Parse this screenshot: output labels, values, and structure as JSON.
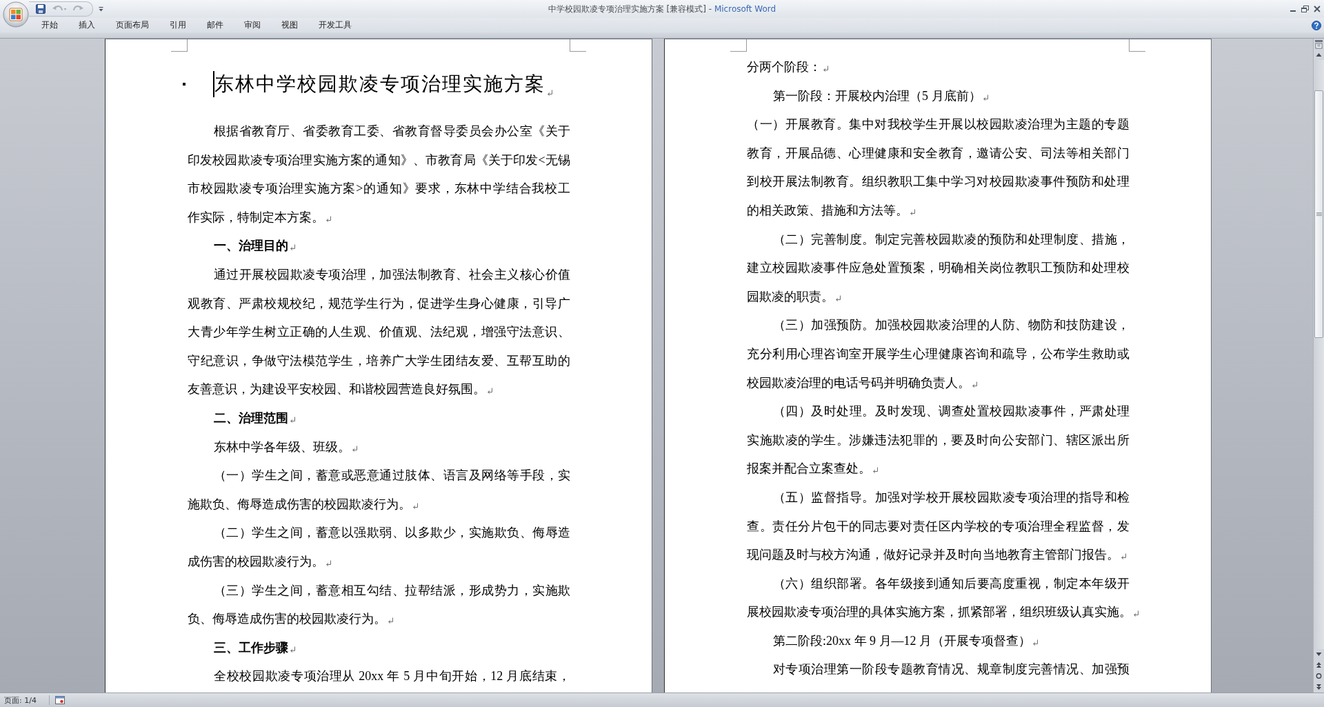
{
  "window": {
    "document": "中学校园欺凌专项治理实施方案 [兼容模式] -",
    "app": "Microsoft Word"
  },
  "quick_access": [
    {
      "kind": "save",
      "disabled": false
    },
    {
      "kind": "undo",
      "disabled": true
    },
    {
      "kind": "redo",
      "disabled": true
    },
    {
      "kind": "customize"
    }
  ],
  "ribbon_tabs": [
    {
      "label": "开始",
      "selected": false
    },
    {
      "label": "插入",
      "selected": false
    },
    {
      "label": "页面布局",
      "selected": false
    },
    {
      "label": "引用",
      "selected": false
    },
    {
      "label": "邮件",
      "selected": false
    },
    {
      "label": "审阅",
      "selected": false
    },
    {
      "label": "视图",
      "selected": false
    },
    {
      "label": "开发工具",
      "selected": false
    }
  ],
  "pages": [
    {
      "title": {
        "text": "东林中学校园欺凌专项治理实施方案",
        "bullet": true,
        "caret": true,
        "end_mark": true
      },
      "paragraphs": [
        {
          "kind": "body",
          "indent": true,
          "end_mark": true,
          "lines": [
            "根据省教育厅、省委教育工委、省教育督导委员会办公室《关于",
            "印发校园欺凌专项治理实施方案的通知》、市教育局《关于印发<无锡",
            "市校园欺凌专项治理实施方案>的通知》要求，东林中学结合我校工",
            "作实际，特制定本方案。"
          ]
        },
        {
          "kind": "heading",
          "indent": true,
          "end_mark": true,
          "lines": [
            "一、治理目的"
          ]
        },
        {
          "kind": "body",
          "indent": true,
          "end_mark": true,
          "lines": [
            "通过开展校园欺凌专项治理，加强法制教育、社会主义核心价值",
            "观教育、严肃校规校纪，规范学生行为，促进学生身心健康，引导广",
            "大青少年学生树立正确的人生观、价值观、法纪观，增强守法意识、",
            "守纪意识，争做守法模范学生，培养广大学生团结友爱、互帮互助的",
            "友善意识，为建设平安校园、和谐校园营造良好氛围。"
          ]
        },
        {
          "kind": "heading",
          "indent": true,
          "end_mark": true,
          "lines": [
            "二、治理范围"
          ]
        },
        {
          "kind": "body",
          "indent": true,
          "end_mark": true,
          "lines": [
            "东林中学各年级、班级。"
          ]
        },
        {
          "kind": "body",
          "indent": true,
          "end_mark": true,
          "lines": [
            "（一）学生之间，蓄意或恶意通过肢体、语言及网络等手段，实",
            "施欺负、侮辱造成伤害的校园欺凌行为。"
          ]
        },
        {
          "kind": "body",
          "indent": true,
          "end_mark": true,
          "lines": [
            "（二）学生之间，蓄意以强欺弱、以多欺少，实施欺负、侮辱造",
            "成伤害的校园欺凌行为。"
          ]
        },
        {
          "kind": "body",
          "indent": true,
          "end_mark": true,
          "lines": [
            "（三）学生之间，蓄意相互勾结、拉帮结派，形成势力，实施欺",
            "负、侮辱造成伤害的校园欺凌行为。"
          ]
        },
        {
          "kind": "heading",
          "indent": true,
          "end_mark": true,
          "lines": [
            "三、工作步骤"
          ]
        },
        {
          "kind": "body",
          "indent": true,
          "end_mark": false,
          "lines": [
            "全校校园欺凌专项治理从 20xx 年 5 月中旬开始，12 月底结束，"
          ]
        }
      ]
    },
    {
      "paragraphs": [
        {
          "kind": "body",
          "indent": false,
          "end_mark": true,
          "lines": [
            "分两个阶段："
          ]
        },
        {
          "kind": "body",
          "indent": true,
          "end_mark": true,
          "lines": [
            "第一阶段：开展校内治理（5 月底前）"
          ]
        },
        {
          "kind": "body",
          "indent": false,
          "end_mark": true,
          "lines": [
            "（一）开展教育。集中对我校学生开展以校园欺凌治理为主题的专题",
            "教育，开展品德、心理健康和安全教育，邀请公安、司法等相关部门",
            "到校开展法制教育。组织教职工集中学习对校园欺凌事件预防和处理",
            "的相关政策、措施和方法等。"
          ]
        },
        {
          "kind": "body",
          "indent": true,
          "end_mark": true,
          "lines": [
            "（二）完善制度。制定完善校园欺凌的预防和处理制度、措施，",
            "建立校园欺凌事件应急处置预案，明确相关岗位教职工预防和处理校",
            "园欺凌的职责。"
          ]
        },
        {
          "kind": "body",
          "indent": true,
          "end_mark": true,
          "lines": [
            "（三）加强预防。加强校园欺凌治理的人防、物防和技防建设，",
            "充分利用心理咨询室开展学生心理健康咨询和疏导，公布学生救助或",
            "校园欺凌治理的电话号码并明确负责人。"
          ]
        },
        {
          "kind": "body",
          "indent": true,
          "end_mark": true,
          "lines": [
            "（四）及时处理。及时发现、调查处置校园欺凌事件，严肃处理",
            "实施欺凌的学生。涉嫌违法犯罪的，要及时向公安部门、辖区派出所",
            "报案并配合立案查处。"
          ]
        },
        {
          "kind": "body",
          "indent": true,
          "end_mark": true,
          "lines": [
            "（五）监督指导。加强对学校开展校园欺凌专项治理的指导和检",
            "查。责任分片包干的同志要对责任区内学校的专项治理全程监督，发",
            "现问题及时与校方沟通，做好记录并及时向当地教育主管部门报告。"
          ]
        },
        {
          "kind": "body",
          "indent": true,
          "end_mark": true,
          "lines": [
            "（六）组织部署。各年级接到通知后要高度重视，制定本年级开",
            "展校园欺凌专项治理的具体实施方案，抓紧部署，组织班级认真实施。"
          ]
        },
        {
          "kind": "body",
          "indent": true,
          "end_mark": true,
          "lines": [
            "第二阶段:20xx 年 9 月—12 月（开展专项督查）"
          ]
        },
        {
          "kind": "body",
          "indent": true,
          "end_mark": false,
          "lines": [
            "对专项治理第一阶段专题教育情况、规章制度完善情况、加强预"
          ]
        }
      ]
    }
  ],
  "status_bar": {
    "page": "页面: 1/4"
  }
}
